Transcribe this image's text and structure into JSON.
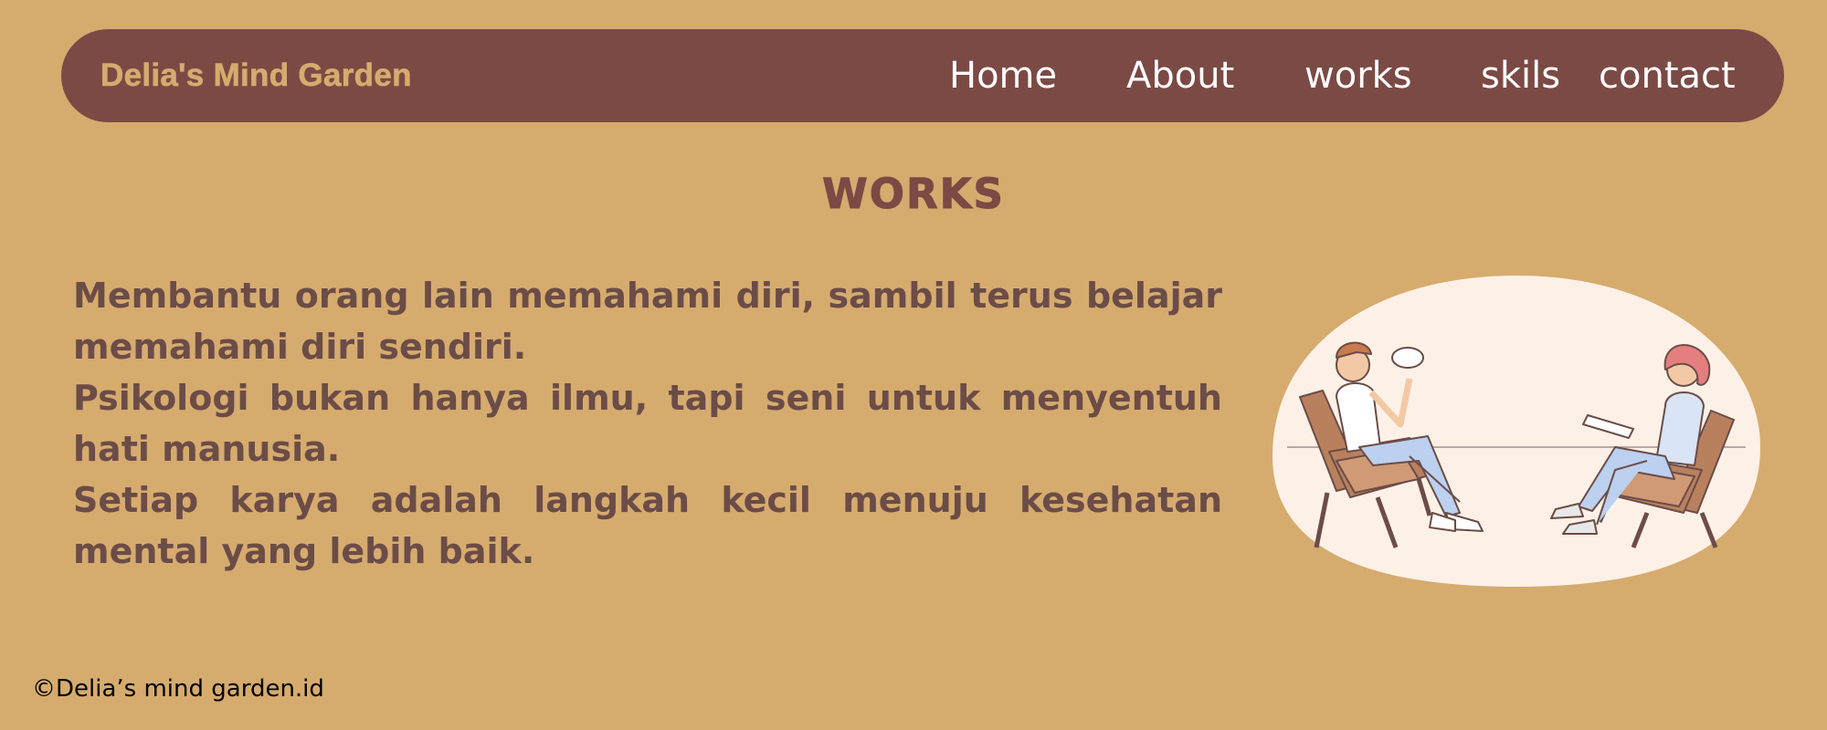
{
  "brand": "Delia's Mind Garden",
  "nav": {
    "home": "Home",
    "about": "About",
    "works": "works",
    "skils": "skils",
    "contact": "contact"
  },
  "section_title": "WORKS",
  "paragraphs": [
    "Membantu orang lain memahami diri, sambil terus belajar memahami diri sendiri.",
    "Psikologi bukan hanya ilmu, tapi seni untuk menyentuh hati manusia.",
    "Setiap karya adalah langkah kecil menuju kesehatan mental yang lebih baik."
  ],
  "footer": "©Delia’s mind garden.id",
  "colors": {
    "background": "#D6AB6E",
    "navbar": "#7B4A45",
    "text": "#6B4C47",
    "illustration_bg": "#FDF1E7"
  }
}
